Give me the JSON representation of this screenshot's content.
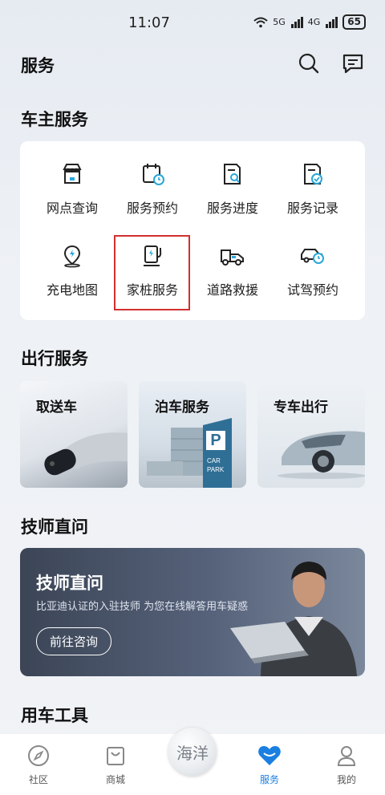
{
  "status_bar": {
    "time": "11:07",
    "net1": "5G",
    "net2": "4G",
    "battery": "65"
  },
  "header": {
    "title": "服务"
  },
  "owner_services": {
    "title": "车主服务",
    "items": [
      {
        "label": "网点查询",
        "icon": "store-icon"
      },
      {
        "label": "服务预约",
        "icon": "calendar-clock-icon"
      },
      {
        "label": "服务进度",
        "icon": "document-search-icon"
      },
      {
        "label": "服务记录",
        "icon": "document-check-icon"
      },
      {
        "label": "充电地图",
        "icon": "charging-map-pin-icon"
      },
      {
        "label": "家桩服务",
        "icon": "home-charger-icon"
      },
      {
        "label": "道路救援",
        "icon": "tow-truck-icon"
      },
      {
        "label": "试驾预约",
        "icon": "car-clock-icon"
      }
    ]
  },
  "travel_services": {
    "title": "出行服务",
    "cards": [
      {
        "label": "取送车"
      },
      {
        "label": "泊车服务",
        "sign_letter": "P",
        "sign_text_1": "CAR",
        "sign_text_2": "PARK"
      },
      {
        "label": "专车出行"
      }
    ]
  },
  "technician": {
    "title": "技师直问",
    "banner_title": "技师直问",
    "banner_subtitle": "比亚迪认证的入驻技师 为您在线解答用车疑惑",
    "banner_button": "前往咨询"
  },
  "tools": {
    "title": "用车工具"
  },
  "tabbar": {
    "items": [
      {
        "label": "社区",
        "icon": "compass-icon"
      },
      {
        "label": "商城",
        "icon": "shopping-bag-icon"
      },
      {
        "label": "海洋",
        "icon": "ocean-logo-icon"
      },
      {
        "label": "服务",
        "icon": "heart-icon",
        "active": true
      },
      {
        "label": "我的",
        "icon": "user-icon"
      }
    ],
    "center_logo_text": "海洋",
    "active_color": "#1a7fe0"
  },
  "colors": {
    "accent": "#1a7fe0",
    "highlight": "#d32f2f"
  }
}
